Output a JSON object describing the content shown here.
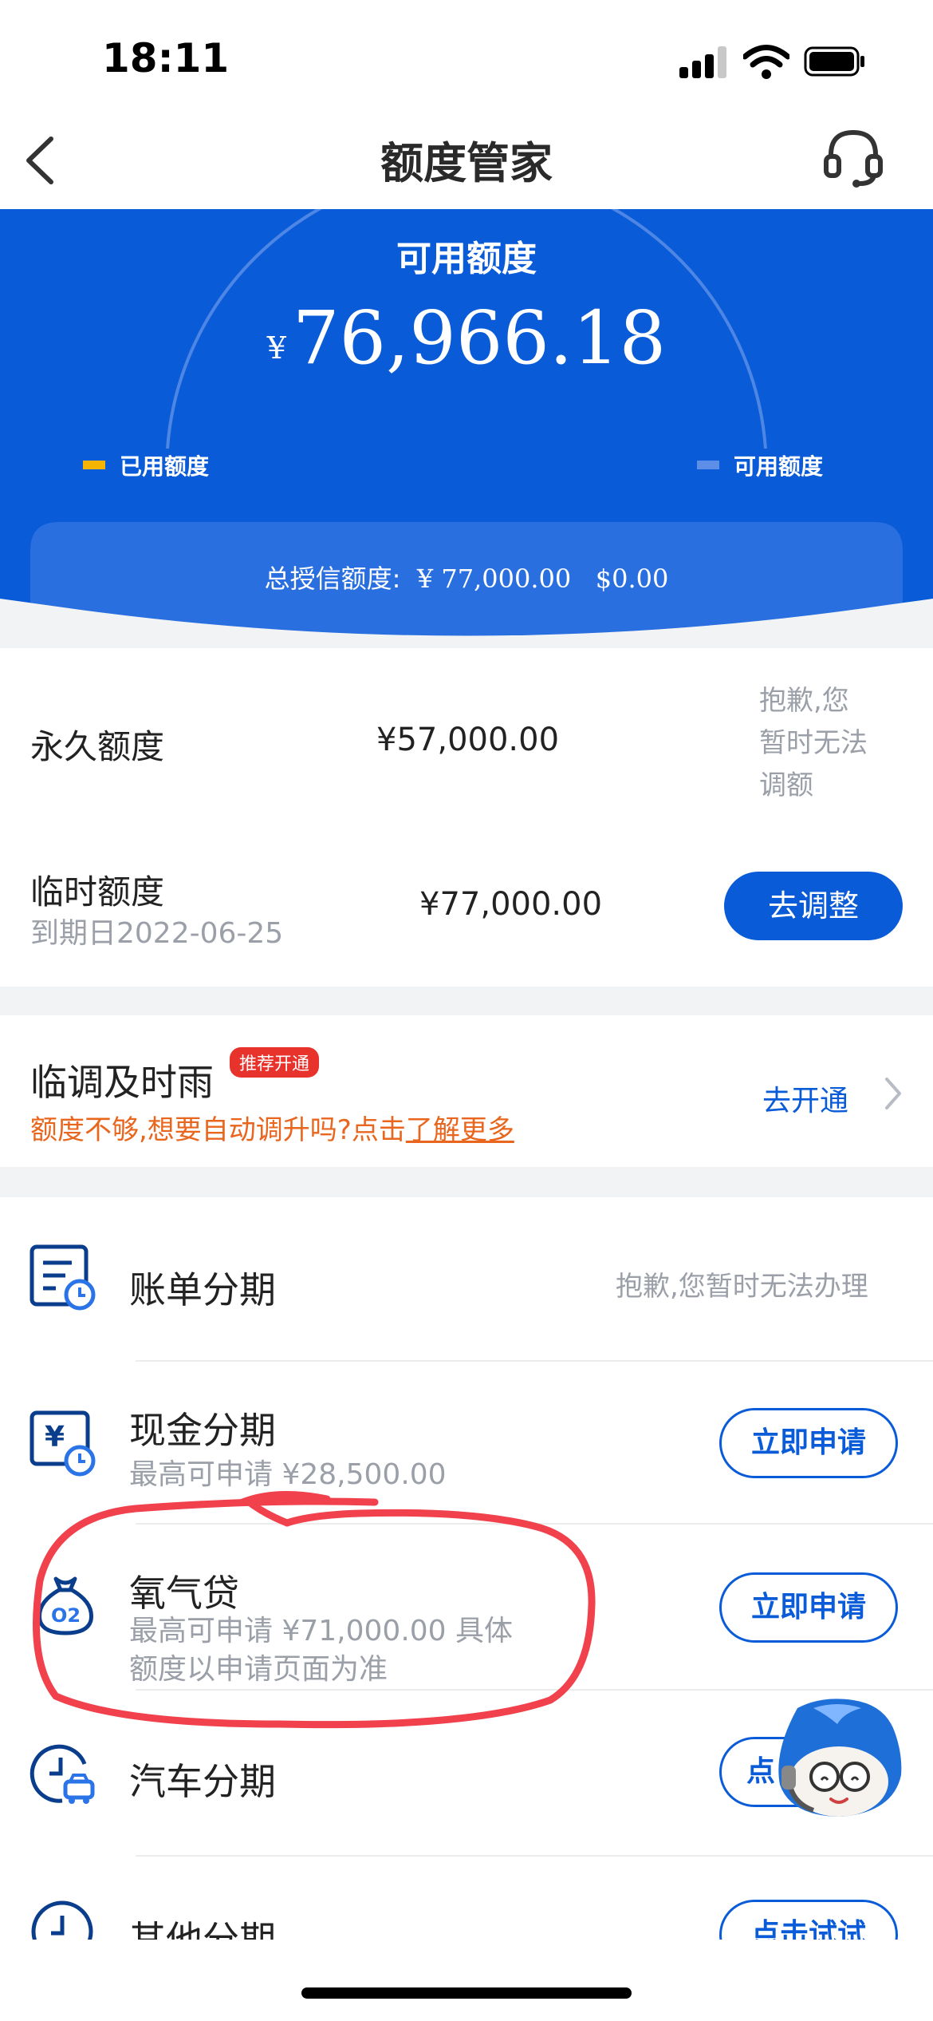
{
  "status_bar": {
    "time": "18:11"
  },
  "nav": {
    "title": "额度管家",
    "back_icon": "chevron-left-icon",
    "service_icon": "headset-icon"
  },
  "header": {
    "label": "可用额度",
    "currency": "¥",
    "amount": "76,966.18",
    "legend_used": "已用额度",
    "legend_available": "可用额度",
    "total_credit_label": "总授信额度:",
    "total_credit_cny": "¥ 77,000.00",
    "total_credit_usd": "$0.00",
    "colors": {
      "bg": "#0a5bd8",
      "used": "#f5b400",
      "available": "#5d8ee8"
    }
  },
  "permanent": {
    "label": "永久额度",
    "amount": "¥57,000.00",
    "note_line1": "抱歉,您",
    "note_line2": "暂时无法",
    "note_line3": "调额"
  },
  "temporary": {
    "label": "临时额度",
    "expiry": "到期日2022-06-25",
    "amount": "¥77,000.00",
    "button": "去调整"
  },
  "timely_rain": {
    "title": "临调及时雨",
    "badge": "推荐开通",
    "desc_prefix": "额度不够,想要自动调升吗?点击",
    "desc_link": "了解更多",
    "action": "去开通"
  },
  "services": [
    {
      "title": "账单分期",
      "icon": "bill-installment-icon",
      "note": "抱歉,您暂时无法办理"
    },
    {
      "title": "现金分期",
      "icon": "cash-installment-icon",
      "sub": "最高可申请 ¥28,500.00",
      "button": "立即申请"
    },
    {
      "title": "氧气贷",
      "icon": "money-bag-o2-icon",
      "sub_line1": "最高可申请 ¥71,000.00 具体",
      "sub_line2": "额度以申请页面为准",
      "button": "立即申请"
    },
    {
      "title": "汽车分期",
      "icon": "car-clock-icon",
      "button": "点"
    },
    {
      "title": "其他分期",
      "icon": "clock-icon",
      "button": "点击试试"
    }
  ],
  "overlay": {
    "mascot": "water-drop-mascot-icon",
    "annotation": "red-circle-annotation"
  }
}
